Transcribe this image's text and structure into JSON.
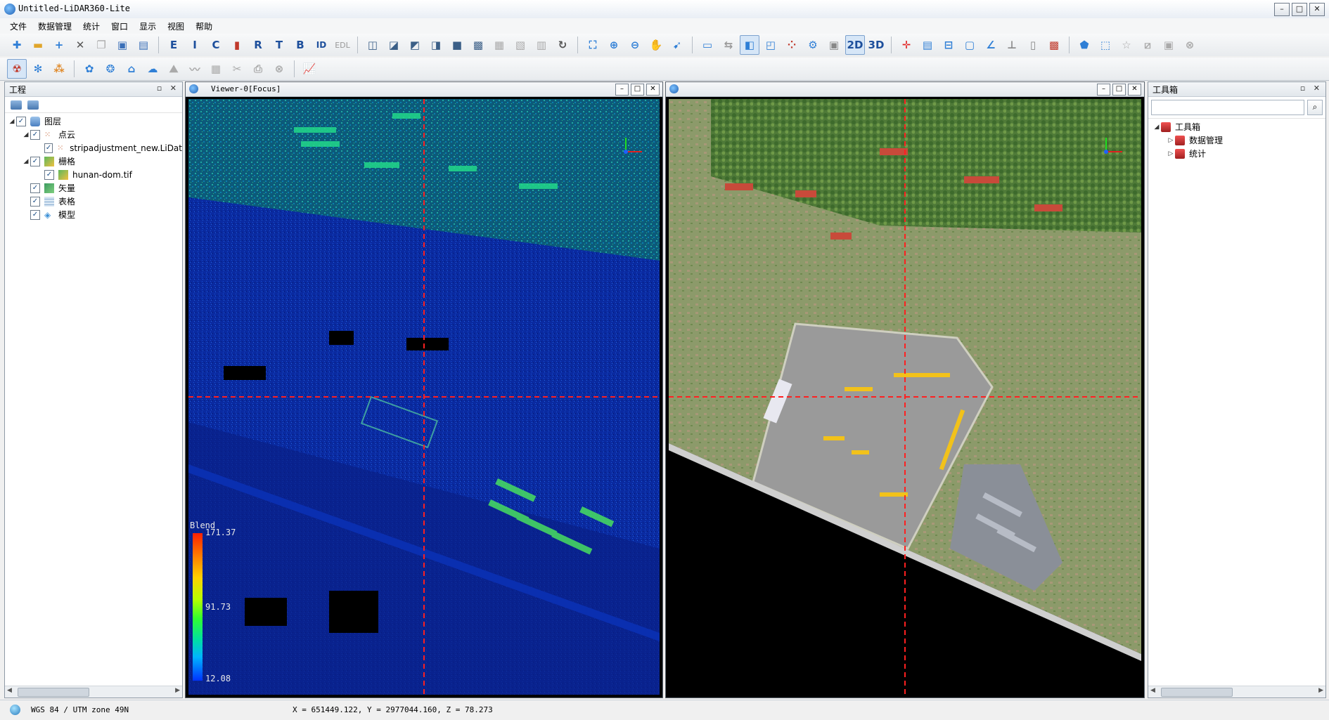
{
  "window": {
    "title": "Untitled-LiDAR360-Lite",
    "btn_min": "–",
    "btn_max": "□",
    "btn_close": "✕"
  },
  "menu": [
    "文件",
    "数据管理",
    "统计",
    "窗口",
    "显示",
    "视图",
    "帮助"
  ],
  "toolbar": {
    "mode_2d": "2D",
    "mode_3d": "3D",
    "edl": "EDL",
    "by_e": "E",
    "by_i": "I",
    "by_c": "C",
    "by_r": "R",
    "by_t": "T",
    "by_b": "B",
    "by_id": "ID"
  },
  "project_panel": {
    "title": "工程",
    "tree": {
      "layers": "图层",
      "pointcloud": "点云",
      "pointcloud_file": "stripadjustment_new.LiDat",
      "raster": "栅格",
      "raster_file": "hunan-dom.tif",
      "vector": "矢量",
      "table": "表格",
      "model": "模型"
    }
  },
  "viewer_left": {
    "title": "Viewer-0[Focus]"
  },
  "viewer_right": {
    "title": ""
  },
  "legend": {
    "title": "Blend",
    "max": "171.37",
    "mid": "91.73",
    "min": "12.08"
  },
  "toolbox_panel": {
    "title": "工具箱",
    "search_placeholder": "",
    "tree": {
      "root": "工具箱",
      "data_management": "数据管理",
      "statistics": "统计"
    }
  },
  "status": {
    "crs": "WGS 84 / UTM zone 49N",
    "coords": "X = 651449.122, Y = 2977044.160, Z = 78.273"
  },
  "colors": {
    "crosshair": "#ff2020",
    "legend_high": "#ff2000",
    "legend_low": "#0033ff",
    "pointcloud_base": "#0a2a9c"
  }
}
